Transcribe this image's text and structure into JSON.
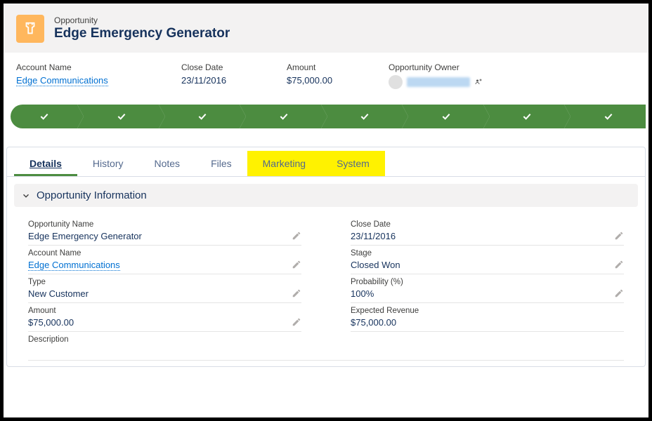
{
  "header": {
    "object_label": "Opportunity",
    "title": "Edge Emergency Generator"
  },
  "summary": {
    "account_name": {
      "label": "Account Name",
      "value": "Edge Communications"
    },
    "close_date": {
      "label": "Close Date",
      "value": "23/11/2016"
    },
    "amount": {
      "label": "Amount",
      "value": "$75,000.00"
    },
    "owner": {
      "label": "Opportunity Owner"
    }
  },
  "path": {
    "steps": 8
  },
  "tabs": [
    {
      "key": "details",
      "label": "Details",
      "active": true,
      "highlight": false
    },
    {
      "key": "history",
      "label": "History",
      "active": false,
      "highlight": false
    },
    {
      "key": "notes",
      "label": "Notes",
      "active": false,
      "highlight": false
    },
    {
      "key": "files",
      "label": "Files",
      "active": false,
      "highlight": false
    },
    {
      "key": "marketing",
      "label": "Marketing",
      "active": false,
      "highlight": true
    },
    {
      "key": "system",
      "label": "System",
      "active": false,
      "highlight": true
    }
  ],
  "section": {
    "title": "Opportunity Information"
  },
  "fields": {
    "left": [
      {
        "key": "opportunity_name",
        "label": "Opportunity Name",
        "value": "Edge Emergency Generator",
        "editable": true
      },
      {
        "key": "account_name",
        "label": "Account Name",
        "value": "Edge Communications",
        "editable": true,
        "link": true
      },
      {
        "key": "type",
        "label": "Type",
        "value": "New Customer",
        "editable": true
      },
      {
        "key": "amount",
        "label": "Amount",
        "value": "$75,000.00",
        "editable": true
      },
      {
        "key": "description",
        "label": "Description",
        "value": "",
        "editable": false,
        "full_row": true
      }
    ],
    "right": [
      {
        "key": "close_date",
        "label": "Close Date",
        "value": "23/11/2016",
        "editable": true
      },
      {
        "key": "stage",
        "label": "Stage",
        "value": "Closed Won",
        "editable": true
      },
      {
        "key": "probability",
        "label": "Probability (%)",
        "value": "100%",
        "editable": true
      },
      {
        "key": "expected_revenue",
        "label": "Expected Revenue",
        "value": "$75,000.00",
        "editable": false
      }
    ]
  }
}
